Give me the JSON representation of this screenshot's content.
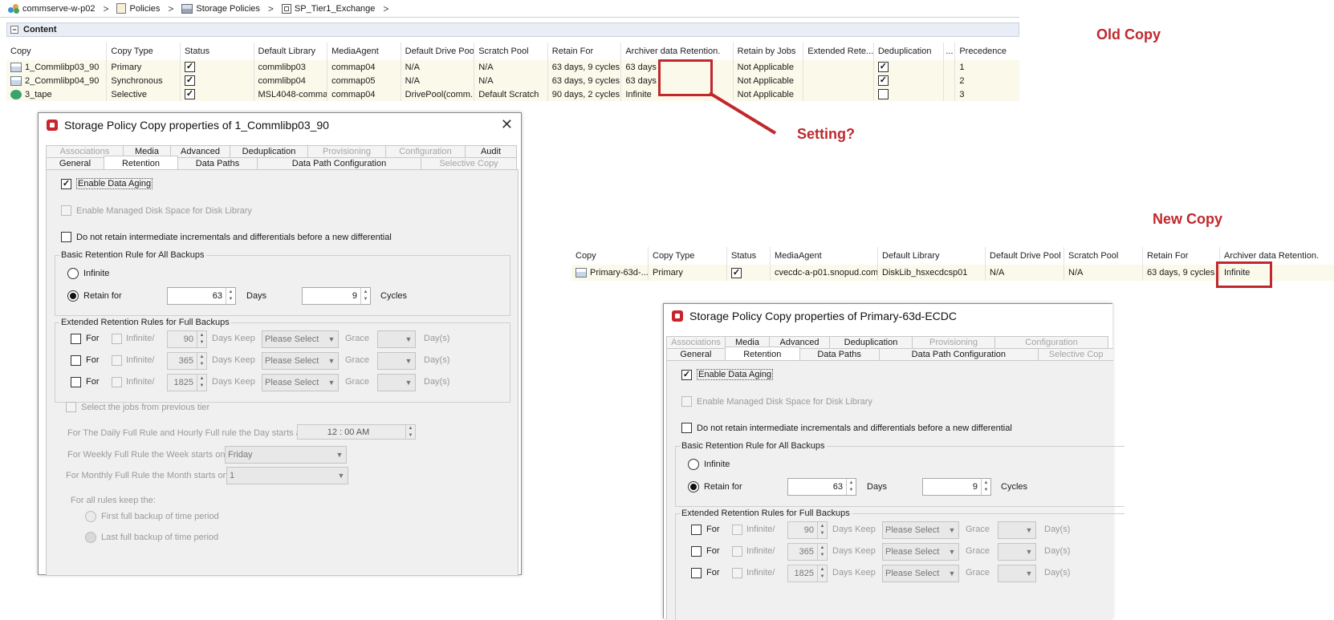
{
  "breadcrumb": {
    "items": [
      "commserve-w-p02",
      "Policies",
      "Storage Policies",
      "SP_Tier1_Exchange"
    ],
    "separator": ">"
  },
  "content_bar": {
    "label": "Content",
    "collapse": "−"
  },
  "old_table": {
    "columns": [
      "Copy",
      "Copy Type",
      "Status",
      "Default Library",
      "MediaAgent",
      "Default Drive Pool",
      "Scratch Pool",
      "Retain For",
      "Archiver data Retention.",
      "Retain by Jobs",
      "Extended Rete...",
      "Deduplication",
      "...",
      "Precedence"
    ],
    "rows": [
      {
        "copy": "1_Commlibp03_90",
        "type": "Primary",
        "status": true,
        "library": "commlibp03",
        "agent": "commap04",
        "drive_pool": "N/A",
        "scratch": "N/A",
        "retain": "63 days, 9 cycles",
        "archiver": "63 days",
        "jobs": "Not Applicable",
        "extended": "",
        "dedup": true,
        "precedence": "1"
      },
      {
        "copy": "2_Commlibp04_90",
        "type": "Synchronous",
        "status": true,
        "library": "commlibp04",
        "agent": "commap05",
        "drive_pool": "N/A",
        "scratch": "N/A",
        "retain": "63 days, 9 cycles",
        "archiver": "63 days",
        "jobs": "Not Applicable",
        "extended": "",
        "dedup": true,
        "precedence": "2"
      },
      {
        "copy": "3_tape",
        "type": "Selective",
        "status": true,
        "library": "MSL4048-comma...",
        "agent": "commap04",
        "drive_pool": "DrivePool(comm...",
        "scratch": "Default Scratch",
        "retain": "90 days, 2 cycles",
        "archiver": "Infinite",
        "jobs": "Not Applicable",
        "extended": "",
        "dedup": false,
        "precedence": "3"
      }
    ]
  },
  "annotations": {
    "old_copy": "Old Copy",
    "new_copy": "New Copy",
    "setting": "Setting?",
    "red": "#c0282d"
  },
  "new_table": {
    "columns": [
      "Copy",
      "Copy Type",
      "Status",
      "MediaAgent",
      "Default Library",
      "Default Drive Pool",
      "Scratch Pool",
      "Retain For",
      "Archiver data Retention."
    ],
    "row": {
      "copy": "Primary-63d-...",
      "type": "Primary",
      "status": true,
      "agent": "cvecdc-a-p01.snopud.com",
      "library": "DiskLib_hsxecdcsp01",
      "drive_pool": "N/A",
      "scratch": "N/A",
      "retain": "63 days, 9 cycles",
      "archiver": "Infinite"
    }
  },
  "dialog_old": {
    "title": "Storage Policy Copy properties of 1_Commlibp03_90",
    "close": "✕",
    "tabs_top": [
      "Associations",
      "Media",
      "Advanced",
      "Deduplication",
      "Provisioning",
      "Configuration",
      "Audit"
    ],
    "tabs_bottom": [
      "General",
      "Retention",
      "Data Paths",
      "Data Path Configuration",
      "Selective Copy"
    ],
    "enable_aging": "Enable Data Aging",
    "managed_disk": "Enable Managed Disk Space for Disk Library",
    "no_retain": "Do not retain intermediate incrementals and differentials before a new differential",
    "basic_group": "Basic Retention Rule for All Backups",
    "infinite": "Infinite",
    "retain_for": "Retain for",
    "days_value": "63",
    "days_label": "Days",
    "cycles_value": "9",
    "cycles_label": "Cycles",
    "extended_group": "Extended Retention Rules for Full Backups",
    "ext_rows": [
      {
        "for": "For",
        "infinite": "Infinite/",
        "days": "90",
        "days_keep": "Days  Keep",
        "select": "Please Select",
        "grace": "Grace",
        "days_unit": "Day(s)"
      },
      {
        "for": "For",
        "infinite": "Infinite/",
        "days": "365",
        "days_keep": "Days  Keep",
        "select": "Please Select",
        "grace": "Grace",
        "days_unit": "Day(s)"
      },
      {
        "for": "For",
        "infinite": "Infinite/",
        "days": "1825",
        "days_keep": "Days  Keep",
        "select": "Please Select",
        "grace": "Grace",
        "days_unit": "Day(s)"
      }
    ],
    "prev_tier": "Select the jobs from previous tier",
    "daily_rule": "For The Daily Full Rule and Hourly Full rule the Day starts at:",
    "daily_time": "12 : 00 AM",
    "weekly_rule": "For Weekly Full Rule the Week starts on:",
    "weekly_value": "Friday",
    "monthly_rule": "For Monthly Full Rule the Month starts on:",
    "monthly_value": "1",
    "all_rules": "For all rules keep the:",
    "first_full": "First full backup of time period",
    "last_full": "Last full backup of time period"
  },
  "dialog_new": {
    "title": "Storage Policy Copy properties of Primary-63d-ECDC",
    "tabs_top": [
      "Associations",
      "Media",
      "Advanced",
      "Deduplication",
      "Provisioning",
      "Configuration"
    ],
    "tabs_bottom": [
      "General",
      "Retention",
      "Data Paths",
      "Data Path Configuration",
      "Selective Cop"
    ],
    "enable_aging": "Enable Data Aging",
    "managed_disk": "Enable Managed Disk Space for Disk Library",
    "no_retain": "Do not retain intermediate incrementals and differentials before a new differential",
    "basic_group": "Basic Retention Rule for All Backups",
    "infinite": "Infinite",
    "retain_for": "Retain for",
    "days_value": "63",
    "days_label": "Days",
    "cycles_value": "9",
    "cycles_label": "Cycles",
    "extended_group": "Extended Retention Rules for Full Backups",
    "ext_rows": [
      {
        "for": "For",
        "infinite": "Infinite/",
        "days": "90",
        "days_keep": "Days  Keep",
        "select": "Please Select",
        "grace": "Grace",
        "days_unit": "Day(s)"
      },
      {
        "for": "For",
        "infinite": "Infinite/",
        "days": "365",
        "days_keep": "Days  Keep",
        "select": "Please Select",
        "grace": "Grace",
        "days_unit": "Day(s)"
      },
      {
        "for": "For",
        "infinite": "Infinite/",
        "days": "1825",
        "days_keep": "Days  Keep",
        "select": "Please Select",
        "grace": "Grace",
        "days_unit": "Day(s)"
      }
    ]
  }
}
